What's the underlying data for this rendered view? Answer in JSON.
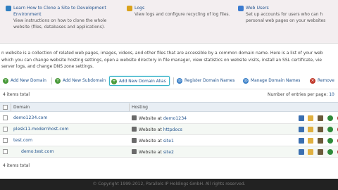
{
  "tips": [
    {
      "title": "Learn How to Clone a Site to Development Environment",
      "desc": [
        "View instructions on how to clone the whole",
        "website (files, databases and applications)."
      ],
      "color": "#2f7fc1"
    },
    {
      "title": "Logs",
      "desc": [
        "View logs and configure recycling of log files."
      ],
      "color": "#d9a21b"
    },
    {
      "title": "Web Users",
      "desc": [
        "Set up accounts for users who can h",
        "personal web pages on your websites"
      ],
      "color": "#3b7bd0"
    }
  ],
  "intro": [
    "n website is a collection of related web pages, images, videos, and other files that are accessible by a common domain name. Here is a list of your web",
    "which you can change website hosting settings, open a website directory in file manager, view statistics on website visits, install an SSL certificate, vie",
    "server logs, and change DNS zone settings."
  ],
  "toolbar": {
    "add_domain": "Add New Domain",
    "add_subdomain": "Add New Subdomain",
    "add_alias": "Add New Domain Alias",
    "register": "Register Domain Names",
    "manage": "Manage Domain Names",
    "remove": "Remove"
  },
  "count": {
    "items": "4 items total",
    "per_page_label": "Number of entries per page:",
    "per_page_value": "10"
  },
  "table": {
    "headers": {
      "domain": "Domain",
      "hosting": "Hosting"
    },
    "rows": [
      {
        "domain": "demo1234.com",
        "hosting_label": "Website at",
        "hosting_target": "demo1234"
      },
      {
        "domain": "plesk11.modernhost.com",
        "hosting_label": "Website at",
        "hosting_target": "httpdocs"
      },
      {
        "domain": "test.com",
        "hosting_label": "Website at",
        "hosting_target": "site1"
      },
      {
        "domain": "demo.test.com",
        "hosting_label": "Website at",
        "hosting_target": "site2"
      }
    ]
  },
  "footer": {
    "items": "4 items total",
    "copyright": "© Copyright 1999-2012, Parallels IP Holdings GmbH. All rights reserved."
  },
  "colors": {
    "link": "#24558f",
    "accent_border": "#39b4c9",
    "header_bg": "#e8eef4"
  }
}
